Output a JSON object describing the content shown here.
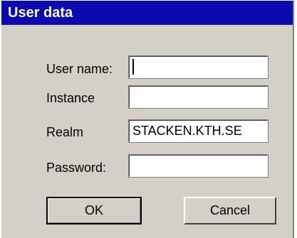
{
  "window": {
    "title": "User data"
  },
  "fields": [
    {
      "label": "User name:",
      "value": ""
    },
    {
      "label": "Instance",
      "value": ""
    },
    {
      "label": "Realm",
      "value": "STACKEN.KTH.SE"
    },
    {
      "label": "Password:",
      "value": ""
    }
  ],
  "buttons": {
    "ok_label": "OK",
    "cancel_label": "Cancel"
  },
  "colors": {
    "titlebar": "#0a0ab0",
    "face": "#d4d0c8"
  }
}
